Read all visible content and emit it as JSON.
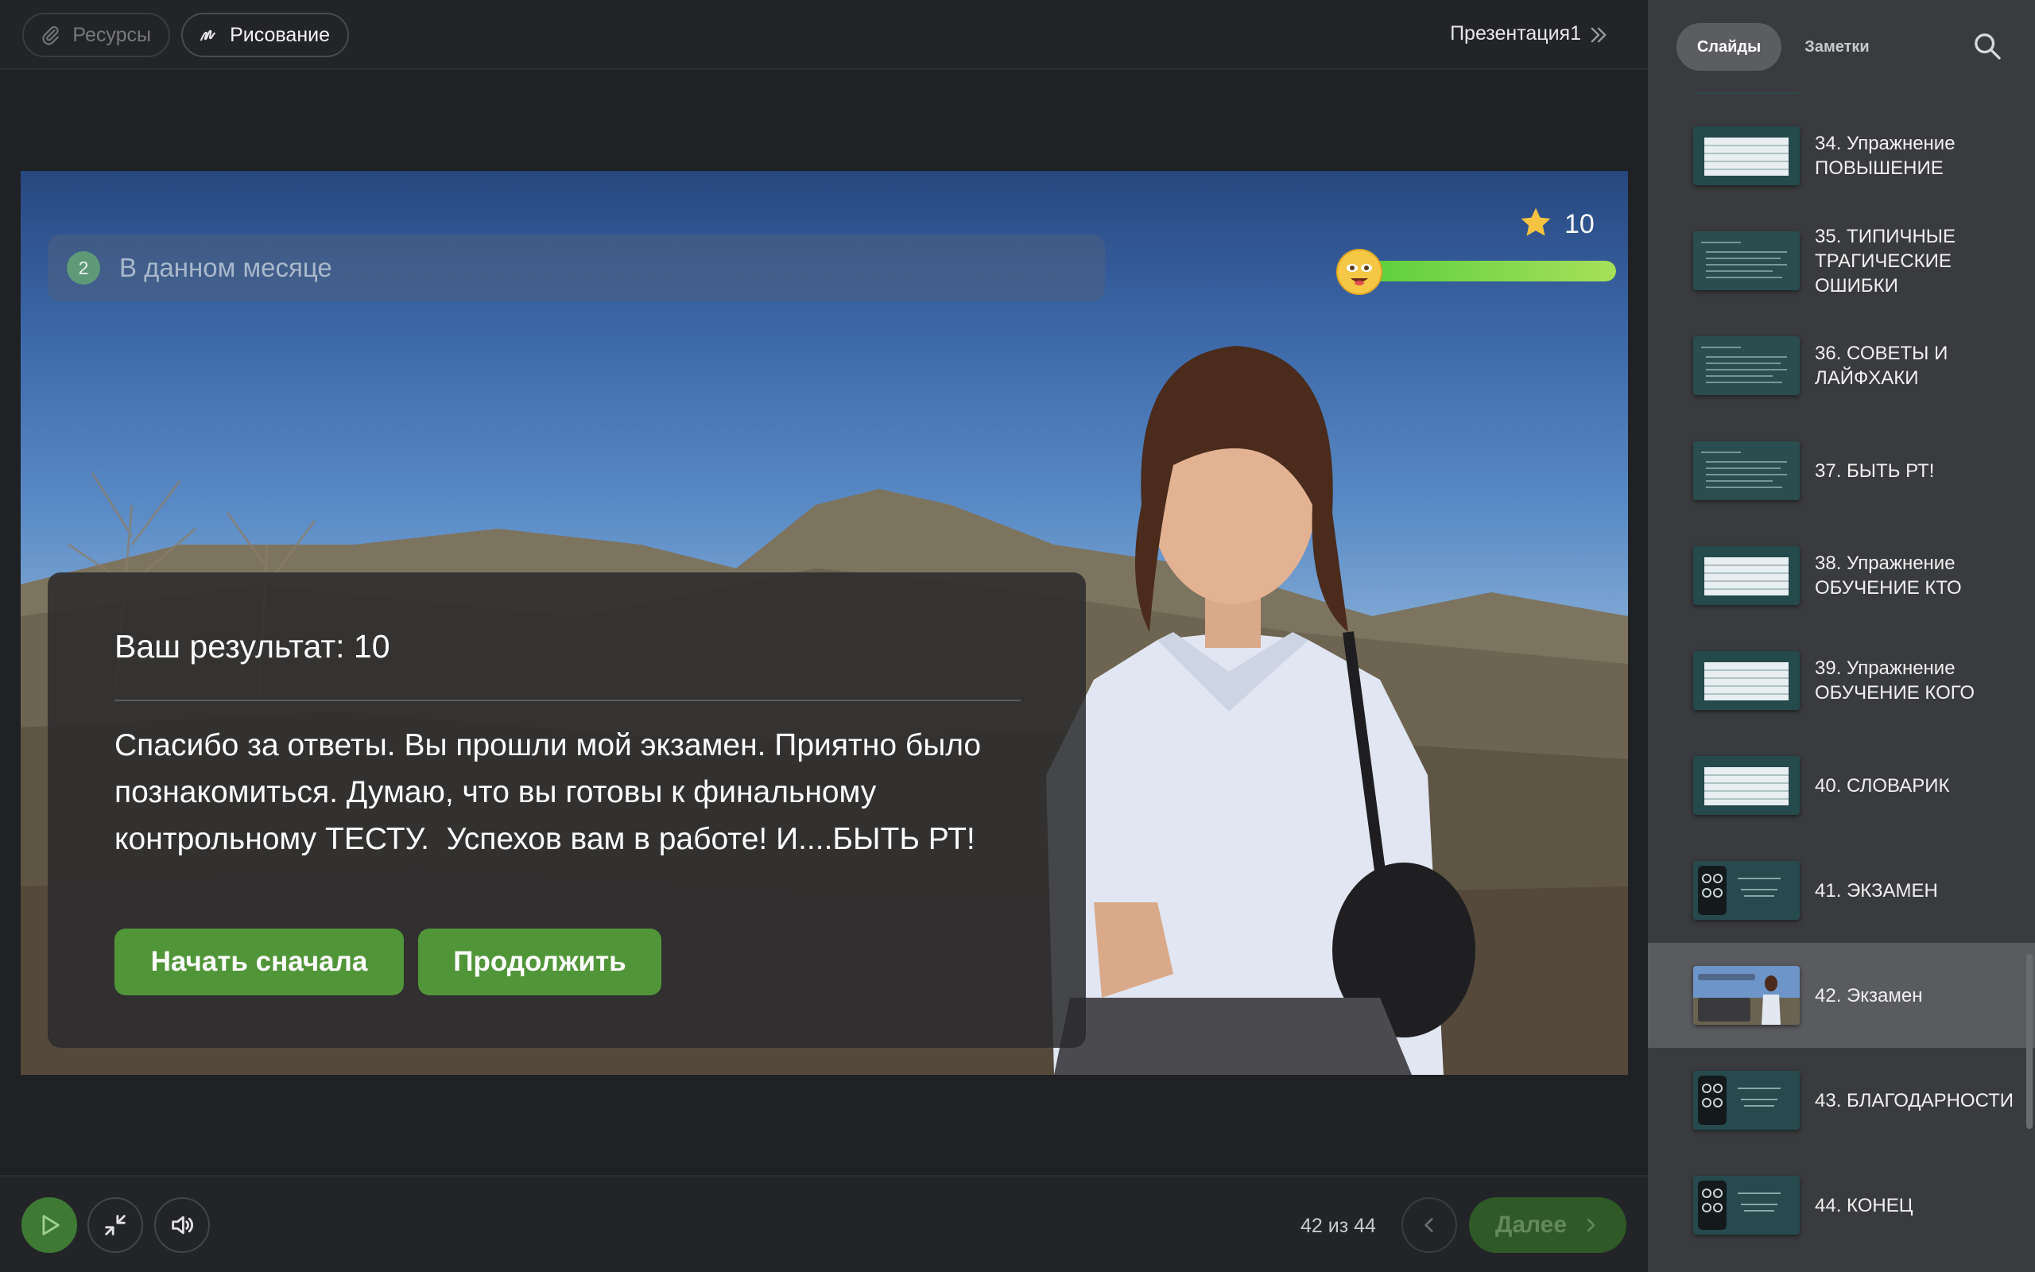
{
  "toolbar": {
    "resources_label": "Ресурсы",
    "drawing_label": "Рисование",
    "presentation_title": "Презентация1"
  },
  "slide": {
    "question_number": "2",
    "question_text": "В данном месяце",
    "score": "10",
    "progress_fraction": 1.0,
    "result_title": "Ваш результат: 10",
    "result_message": "Спасибо за ответы. Вы прошли мой экзамен. Приятно было познакомиться. Думаю, что вы готовы к финальному контрольному ТЕСТУ.  Успехов вам в работе! И....БЫТЬ РТ!",
    "restart_label": "Начать сначала",
    "continue_label": "Продолжить"
  },
  "bottombar": {
    "pager": "42 из 44",
    "next_label": "Далее"
  },
  "sidebar": {
    "tabs": {
      "slides": "Слайды",
      "notes": "Заметки"
    },
    "items": [
      {
        "label": "34. Упражнение ПОВЫШЕНИЕ",
        "thumb": "table"
      },
      {
        "label": "35. ТИПИЧНЫЕ ТРАГИЧЕСКИЕ ОШИБКИ",
        "thumb": "text"
      },
      {
        "label": "36. СОВЕТЫ И ЛАЙФХАКИ",
        "thumb": "text"
      },
      {
        "label": "37. БЫТЬ РТ!",
        "thumb": "text"
      },
      {
        "label": "38. Упражнение ОБУЧЕНИЕ КТО",
        "thumb": "table"
      },
      {
        "label": "39. Упражнение ОБУЧЕНИЕ КОГО",
        "thumb": "table"
      },
      {
        "label": "40. СЛОВАРИК",
        "thumb": "table"
      },
      {
        "label": "41. ЭКЗАМЕН",
        "thumb": "phone"
      },
      {
        "label": "42. Экзамен",
        "thumb": "photo",
        "selected": true
      },
      {
        "label": "43. БЛАГОДАРНОСТИ",
        "thumb": "phone"
      },
      {
        "label": "44. КОНЕЦ",
        "thumb": "phone"
      }
    ]
  },
  "colors": {
    "accent_green": "#519539",
    "background": "#202125",
    "sidebar": "#3a3b3e"
  }
}
